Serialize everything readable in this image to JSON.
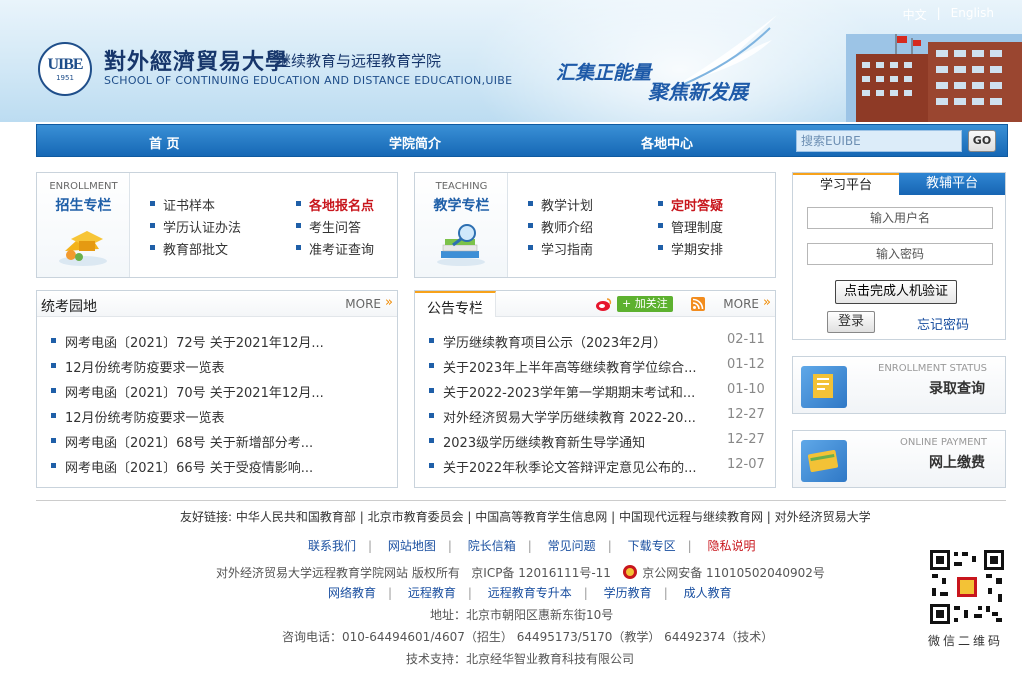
{
  "header": {
    "lang_zh": "中文",
    "lang_sep": "|",
    "lang_en": "English",
    "logo_text": "UIBE",
    "logo_year": "1951",
    "university_name": "對外經濟貿易大學",
    "college_name": "继续教育与远程教育学院",
    "college_en": "SCHOOL OF CONTINUING EDUCATION AND DISTANCE EDUCATION,UIBE",
    "slogan_1": "汇集正能量",
    "slogan_2": "聚焦新发展"
  },
  "nav": {
    "items": [
      "首 页",
      "学院简介",
      "各地中心"
    ],
    "search_placeholder": "搜索EUIBE",
    "search_button": "GO"
  },
  "enrollment": {
    "en": "ENROLLMENT",
    "cn": "招生专栏",
    "links": [
      "证书样本",
      "学历认证办法",
      "教育部批文",
      "各地报名点",
      "考生问答",
      "准考证查询"
    ]
  },
  "teaching": {
    "en": "TEACHING",
    "cn": "教学专栏",
    "links": [
      "教学计划",
      "教师介绍",
      "学习指南",
      "定时答疑",
      "管理制度",
      "学期安排"
    ]
  },
  "login": {
    "tab_learn": "学习平台",
    "tab_tutor": "教辅平台",
    "username_placeholder": "输入用户名",
    "password_placeholder": "输入密码",
    "verify": "点击完成人机验证",
    "login": "登录",
    "forgot": "忘记密码"
  },
  "panels": {
    "status_en": "ENROLLMENT STATUS",
    "status_cn": "录取查询",
    "payment_en": "ONLINE PAYMENT",
    "payment_cn": "网上缴费"
  },
  "exam": {
    "title": "统考园地",
    "more": "MORE",
    "items": [
      "网考电函〔2021〕72号 关于2021年12月...",
      "12月份统考防疫要求一览表",
      "网考电函〔2021〕70号 关于2021年12月...",
      "12月份统考防疫要求一览表",
      "网考电函〔2021〕68号 关于新增部分考...",
      "网考电函〔2021〕66号 关于受疫情影响..."
    ]
  },
  "notice": {
    "title": "公告专栏",
    "follow": "加关注",
    "more": "MORE",
    "items": [
      {
        "text": "学历继续教育项目公示（2023年2月）",
        "date": "02-11"
      },
      {
        "text": "关于2023年上半年高等继续教育学位综合...",
        "date": "01-12"
      },
      {
        "text": "关于2022-2023学年第一学期期末考试和...",
        "date": "01-10"
      },
      {
        "text": "对外经济贸易大学学历继续教育 2022-20...",
        "date": "12-27"
      },
      {
        "text": "2023级学历继续教育新生导学通知",
        "date": "12-27"
      },
      {
        "text": "关于2022年秋季论文答辩评定意见公布的...",
        "date": "12-07"
      }
    ]
  },
  "footer": {
    "friend_label": "友好链接:",
    "friend_links": [
      "中华人民共和国教育部",
      "北京市教育委员会",
      "中国高等教育学生信息网",
      "中国现代远程与继续教育网",
      "对外经济贸易大学"
    ],
    "links": [
      "联系我们",
      "网站地图",
      "院长信箱",
      "常见问题",
      "下载专区",
      "隐私说明"
    ],
    "copyright": "对外经济贸易大学远程教育学院网站 版权所有",
    "icp": "京ICP备 12016111号-11",
    "police": "京公网安备 11010502040902号",
    "links2": [
      "网络教育",
      "远程教育",
      "远程教育专升本",
      "学历教育",
      "成人教育"
    ],
    "address": "地址：北京市朝阳区惠新东街10号",
    "phone": "咨询电话：010-64494601/4607（招生） 64495173/5170（教学） 64492374（技术）",
    "tech": "技术支持：北京经华智业教育科技有限公司",
    "qr_label": "微信二维码"
  },
  "colors": {
    "brand_blue": "#1f5fa8",
    "nav_blue": "#1668b5",
    "accent_red": "#c8161d",
    "accent_orange": "#f08a00"
  }
}
